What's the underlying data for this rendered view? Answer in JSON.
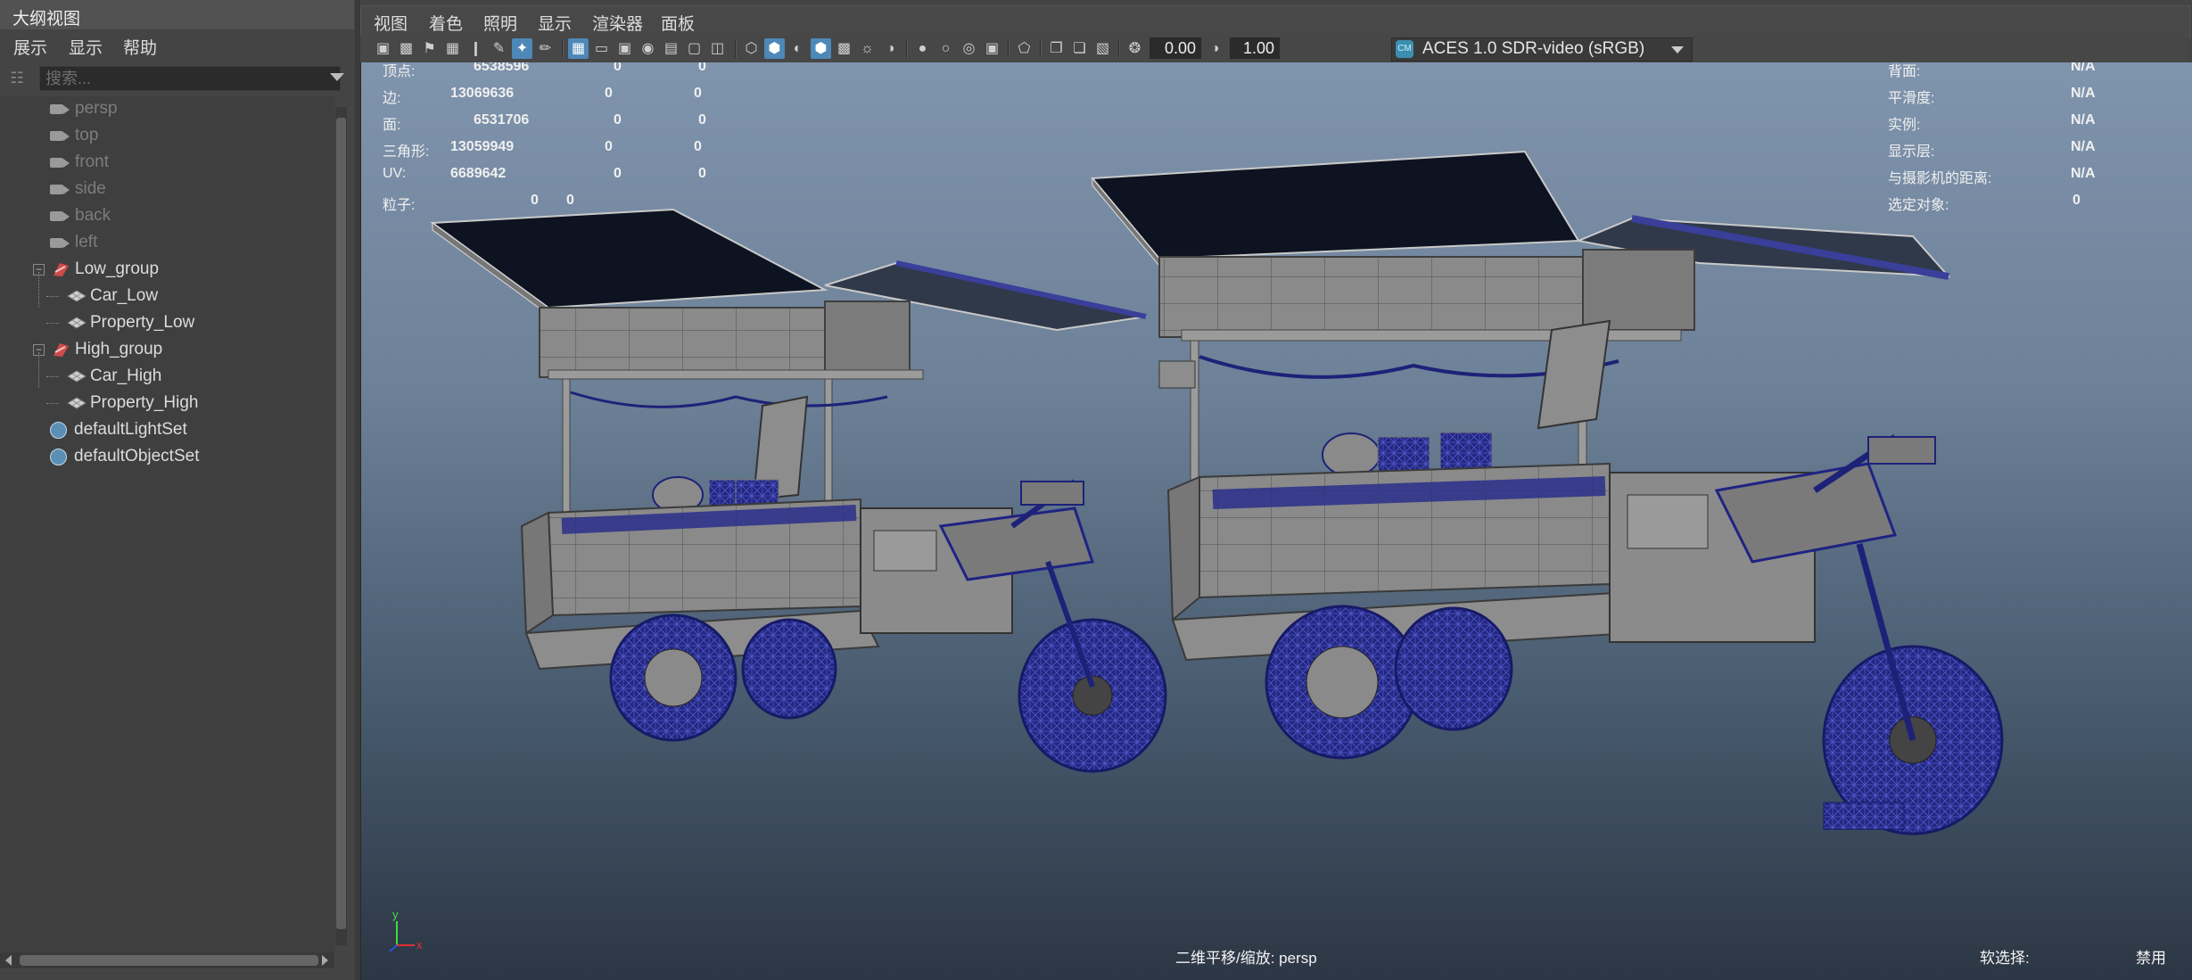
{
  "outliner": {
    "title": "大纲视图",
    "menu": [
      "展示",
      "显示",
      "帮助"
    ],
    "search_placeholder": "搜索...",
    "cameras": [
      "persp",
      "top",
      "front",
      "side",
      "back",
      "left"
    ],
    "groups": [
      {
        "label": "Low_group",
        "children": [
          "Car_Low",
          "Property_Low"
        ]
      },
      {
        "label": "High_group",
        "children": [
          "Car_High",
          "Property_High"
        ]
      }
    ],
    "sets": [
      "defaultLightSet",
      "defaultObjectSet"
    ]
  },
  "viewport_menu": [
    "视图",
    "着色",
    "照明",
    "显示",
    "渲染器",
    "面板"
  ],
  "toolbar": {
    "exposure": "0.00",
    "gamma": "1.00",
    "color_management": "ACES 1.0 SDR-video (sRGB)",
    "cm_icon_label": "CM"
  },
  "hud_left": {
    "rows": [
      {
        "label": "顶点:",
        "v1": "6538596",
        "v2": "0",
        "v3": "0"
      },
      {
        "label": "边:",
        "v1": "13069636",
        "v2": "0",
        "v3": "0"
      },
      {
        "label": "面:",
        "v1": "6531706",
        "v2": "0",
        "v3": "0"
      },
      {
        "label": "三角形:",
        "v1": "13059949",
        "v2": "0",
        "v3": "0"
      },
      {
        "label": "UV:",
        "v1": "6689642",
        "v2": "0",
        "v3": "0"
      },
      {
        "label": "粒子:",
        "v1": "0",
        "v2": "0",
        "v3": ""
      }
    ]
  },
  "hud_right": {
    "rows": [
      {
        "label": "背面:",
        "value": "N/A"
      },
      {
        "label": "平滑度:",
        "value": "N/A"
      },
      {
        "label": "实例:",
        "value": "N/A"
      },
      {
        "label": "显示层:",
        "value": "N/A"
      },
      {
        "label": "与摄影机的距离:",
        "value": "N/A"
      },
      {
        "label": "选定对象:",
        "value": "0"
      }
    ]
  },
  "status": {
    "camera": "二维平移/缩放: persp",
    "soft_select_label": "软选择:",
    "soft_select_value": "禁用"
  },
  "axis": {
    "y": "y",
    "x": "x"
  },
  "colors": {
    "wire": "#1a1f8a",
    "mesh_fill": "#8c8c8c",
    "canopy_top": "#111a2a",
    "selection_blue": "#4d88b8"
  }
}
